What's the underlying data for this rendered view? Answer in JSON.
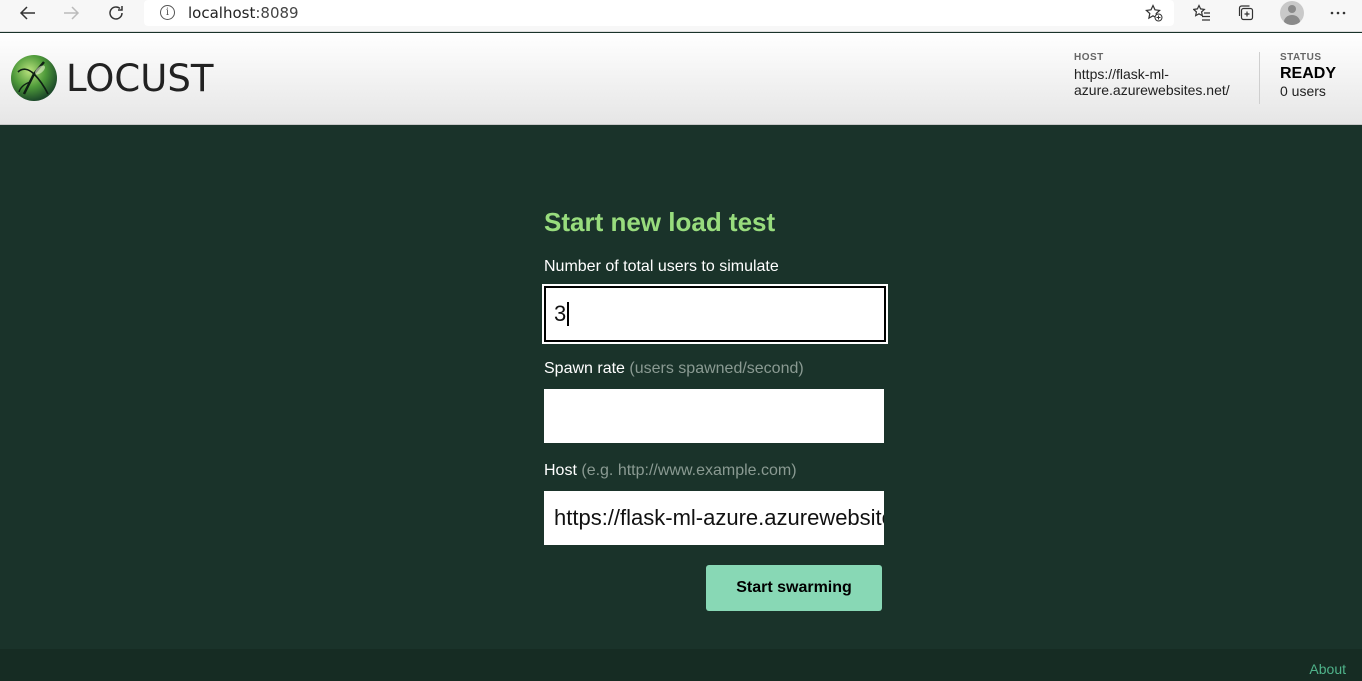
{
  "browser": {
    "url_host": "localhost",
    "url_port": ":8089",
    "icons": [
      "back-icon",
      "forward-icon",
      "reload-icon",
      "info-icon",
      "favorite-add-icon",
      "favorites-icon",
      "collections-icon",
      "profile-icon",
      "more-icon"
    ]
  },
  "header": {
    "logo_text": "LOCUST",
    "host_label": "HOST",
    "host_value": "https://flask-ml-azure.azurewebsites.net/",
    "status_label": "STATUS",
    "status_value": "READY",
    "users_value": "0 users"
  },
  "form": {
    "title": "Start new load test",
    "users_label": "Number of total users to simulate",
    "users_value": "3",
    "spawn_label": "Spawn rate",
    "spawn_hint": "(users spawned/second)",
    "spawn_value": "",
    "host_label": "Host",
    "host_hint": "(e.g. http://www.example.com)",
    "host_value": "https://flask-ml-azure.azurewebsites.net/",
    "submit_label": "Start swarming"
  },
  "footer": {
    "about_label": "About"
  },
  "colors": {
    "page_bg": "#1a332a",
    "title_green": "#98dc7d",
    "button_bg": "#88d8b5",
    "about_link": "#4fb38a"
  }
}
